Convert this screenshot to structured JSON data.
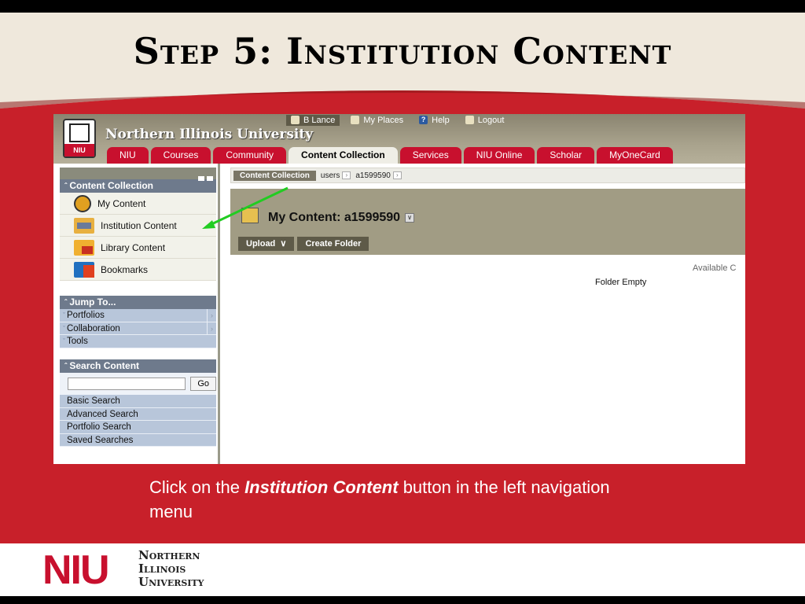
{
  "slide": {
    "title": "Step 5: Institution Content",
    "caption_pre": "Click on the ",
    "caption_emph": "Institution Content",
    "caption_post": " button in the left navigation menu"
  },
  "portal": {
    "university_name": "Northern Illinois University",
    "logo_text": "NIU",
    "util_links": [
      {
        "label": "B Lance",
        "icon": "user-icon"
      },
      {
        "label": "My Places",
        "icon": "places-icon"
      },
      {
        "label": "Help",
        "icon": "help-icon"
      },
      {
        "label": "Logout",
        "icon": "logout-icon"
      }
    ],
    "tabs": [
      "NIU",
      "Courses",
      "Community",
      "Content Collection",
      "Services",
      "NIU Online",
      "Scholar",
      "MyOneCard"
    ],
    "active_tab": "Content Collection"
  },
  "left_nav": {
    "content_collection": {
      "header": "Content Collection",
      "items": [
        "My Content",
        "Institution Content",
        "Library Content",
        "Bookmarks"
      ]
    },
    "jump_to": {
      "header": "Jump To...",
      "items": [
        "Portfolios",
        "Collaboration",
        "Tools"
      ]
    },
    "search": {
      "header": "Search Content",
      "go_label": "Go",
      "links": [
        "Basic Search",
        "Advanced Search",
        "Portfolio Search",
        "Saved Searches"
      ]
    }
  },
  "main": {
    "breadcrumb": [
      "Content Collection",
      "users",
      "a1599590"
    ],
    "title": "My Content: a1599590",
    "upload_label": "Upload",
    "create_folder_label": "Create Folder",
    "available_text": "Available C",
    "empty_text": "Folder Empty"
  },
  "footer": {
    "logo_text": "NIU",
    "name_lines": [
      "Northern",
      "Illinois",
      "University"
    ]
  },
  "colors": {
    "niu_red": "#c8102e",
    "annotation_arrow": "#22cc22"
  }
}
